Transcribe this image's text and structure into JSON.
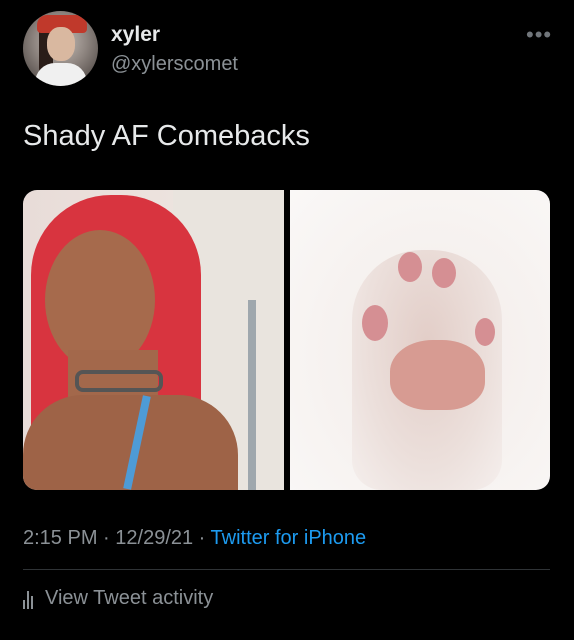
{
  "author": {
    "name": "xyler",
    "handle": "@xylerscomet"
  },
  "more_icon": "more-horizontal-icon",
  "tweet": {
    "text": "Shady AF Comebacks"
  },
  "meta": {
    "time": "2:15 PM",
    "sep1": " · ",
    "date": "12/29/21",
    "sep2": " · ",
    "source": "Twitter for iPhone"
  },
  "activity": {
    "label": "View Tweet activity",
    "icon": "bar-chart-icon"
  },
  "colors": {
    "background": "#000000",
    "text_primary": "#e7e9ea",
    "text_secondary": "#8b9196",
    "link": "#1d9bf0"
  }
}
